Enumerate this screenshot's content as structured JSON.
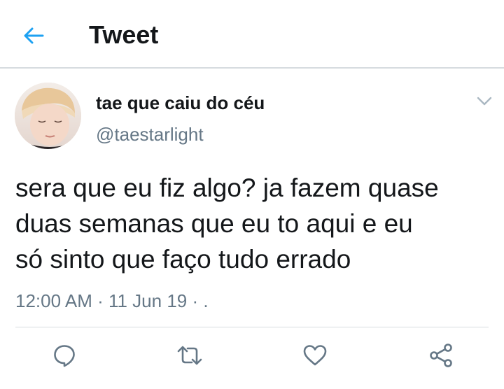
{
  "header": {
    "title": "Tweet",
    "back_icon": "arrow-left-icon"
  },
  "tweet": {
    "display_name": "tae que caiu do céu",
    "handle": "@taestarlight",
    "text_lines": [
      "sera que eu fiz algo? ja fazem quase",
      "duas semanas que eu to aqui e eu",
      "só sinto que faço tudo errado"
    ],
    "timestamp": "12:00 AM · 11 Jun 19 · ."
  },
  "actions": [
    {
      "name": "reply",
      "icon": "reply-icon"
    },
    {
      "name": "retweet",
      "icon": "retweet-icon"
    },
    {
      "name": "like",
      "icon": "heart-icon"
    },
    {
      "name": "share",
      "icon": "share-icon"
    }
  ],
  "colors": {
    "accent": "#1da1f2",
    "text": "#14171a",
    "secondary": "#657786",
    "divider": "#d6dbdf"
  }
}
